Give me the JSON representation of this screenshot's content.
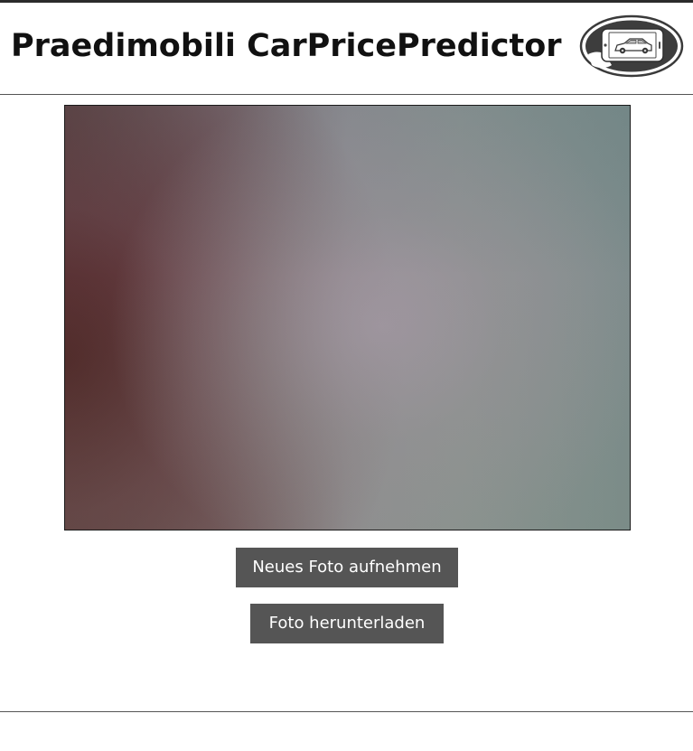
{
  "header": {
    "title": "Praedimobili CarPricePredictor",
    "logo_icon": "phone-car-logo-icon"
  },
  "camera": {
    "icon": "camera-preview"
  },
  "actions": {
    "capture_label": "Neues Foto aufnehmen",
    "download_label": "Foto herunterladen"
  },
  "colors": {
    "button_bg": "#555555",
    "button_text": "#ffffff",
    "title_text": "#111111"
  }
}
